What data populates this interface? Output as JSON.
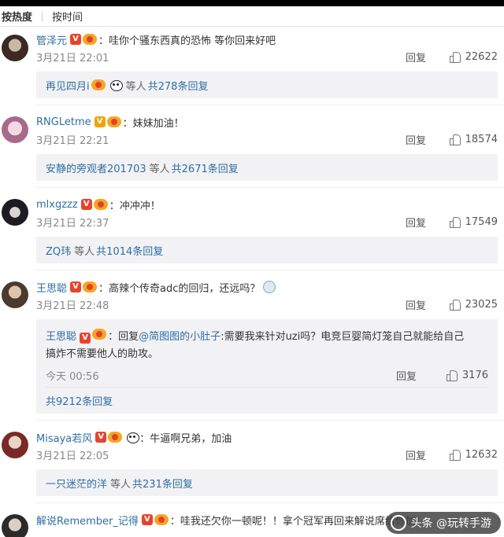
{
  "sort": {
    "hot": "按热度",
    "time": "按时间"
  },
  "labels": {
    "reply": "回复",
    "etc_people": "等人"
  },
  "comments": [
    {
      "user": "管泽元",
      "text": "：哇你个骚东西真的恐怖 等你回来好吧",
      "time": "3月21日 22:01",
      "likes": "22622",
      "replies_from": "再见四月i",
      "replies_count": "共278条回复"
    },
    {
      "user": "RNGLetme",
      "text": "：妹妹加油！",
      "time": "3月21日 22:21",
      "likes": "18574",
      "replies_from": "安静的旁观者201703",
      "replies_count": "共2671条回复"
    },
    {
      "user": "mlxgzzz",
      "text": "：冲冲冲！",
      "time": "3月21日 22:37",
      "likes": "17549",
      "replies_from": "ZQ玮",
      "replies_count": "共1014条回复"
    },
    {
      "user": "王思聪",
      "text": "：高辣个传奇adc的回归，还远吗？",
      "time": "3月21日 22:48",
      "likes": "23025",
      "sub_reply": {
        "user": "王思聪",
        "prefix": "：回复",
        "mention": "@简图图的小肚子",
        "text_line1": ":需要我来针对uzi吗？电竞巨婴简灯笼自己就能给自己",
        "text_line2": "搞炸不需要他人的助攻。",
        "time": "今天 00:56",
        "likes": "3176"
      },
      "replies_count": "共9212条回复"
    },
    {
      "user": "Misaya若风",
      "text": "：牛逼啊兄弟，加油",
      "time": "3月21日 22:05",
      "likes": "12632",
      "replies_from": "一只迷茫的洋",
      "replies_count": "共231条回复"
    },
    {
      "user": "解说Remember_记得",
      "text": "：哇我还欠你一顿呢！！拿个冠军再回来解说席给你加",
      "time": "",
      "likes": ""
    }
  ],
  "watermark": "头条 @玩转手游"
}
